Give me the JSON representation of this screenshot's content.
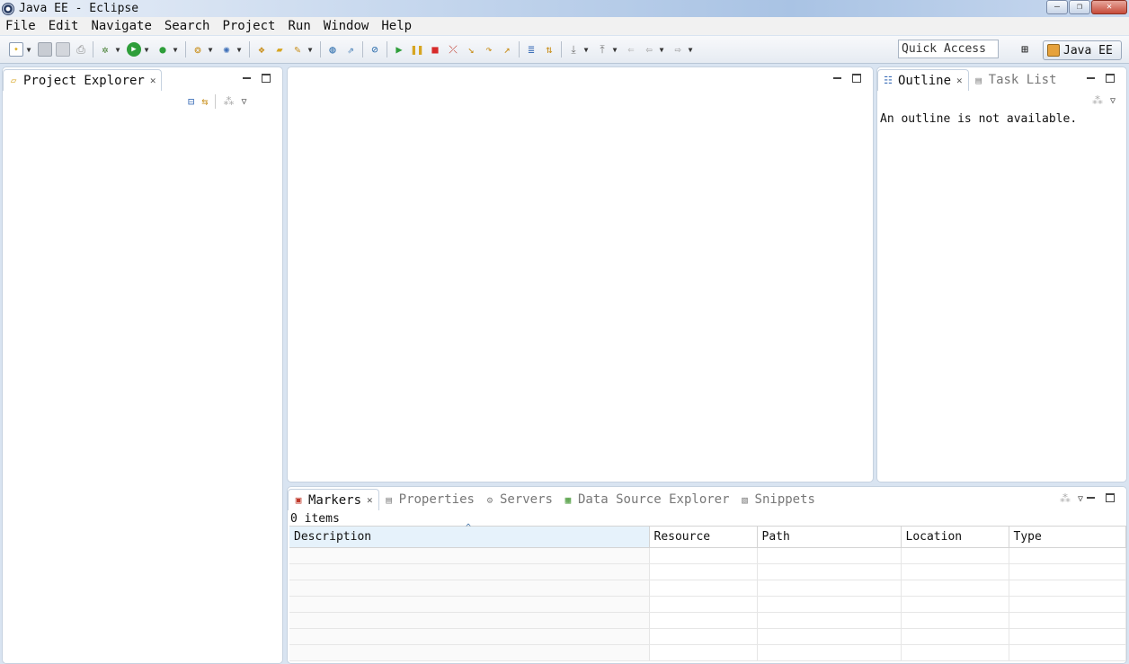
{
  "window": {
    "title": "Java EE - Eclipse"
  },
  "menu": [
    "File",
    "Edit",
    "Navigate",
    "Search",
    "Project",
    "Run",
    "Window",
    "Help"
  ],
  "toolbar": {
    "quick_access_placeholder": "Quick Access",
    "perspective": "Java EE"
  },
  "project_explorer": {
    "tab_label": "Project Explorer"
  },
  "outline": {
    "tabs": [
      "Outline",
      "Task List"
    ],
    "message": "An outline is not available."
  },
  "bottom": {
    "tabs": [
      "Markers",
      "Properties",
      "Servers",
      "Data Source Explorer",
      "Snippets"
    ],
    "item_count": "0 items",
    "columns": [
      "Description",
      "Resource",
      "Path",
      "Location",
      "Type"
    ]
  }
}
